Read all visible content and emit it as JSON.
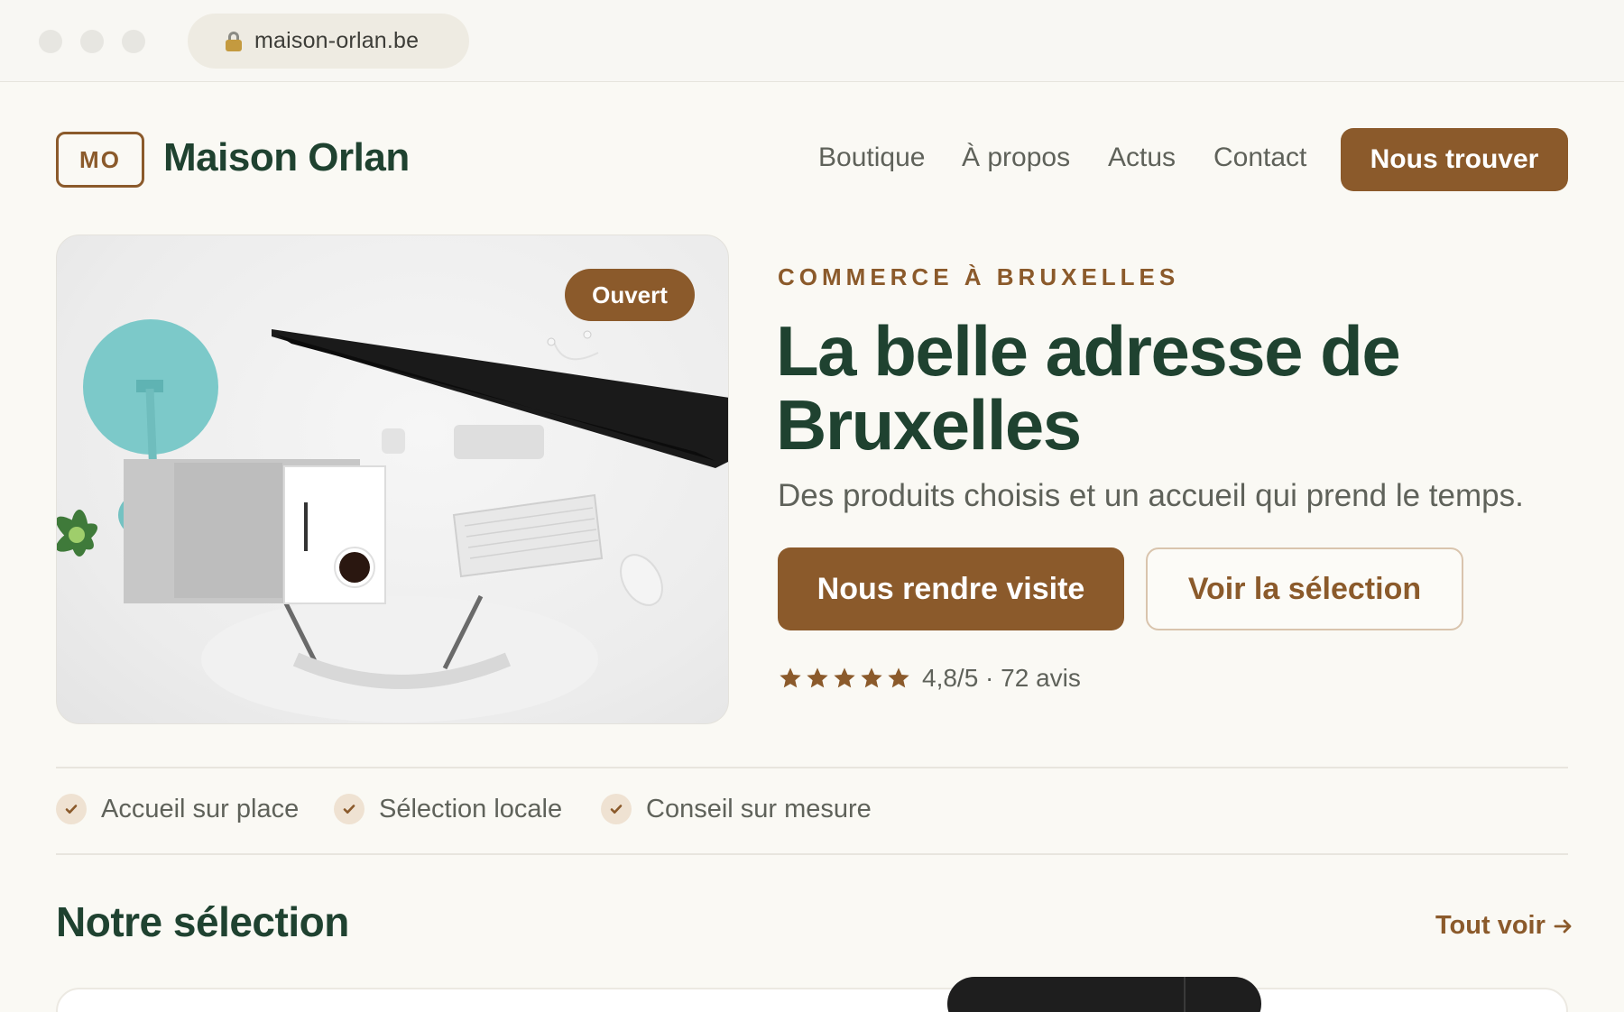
{
  "browser": {
    "url": "maison-orlan.be"
  },
  "header": {
    "logo_mark": "MO",
    "brand_name": "Maison Orlan",
    "nav": [
      "Boutique",
      "À propos",
      "Actus",
      "Contact"
    ],
    "cta_label": "Nous trouver"
  },
  "hero": {
    "badge": "Ouvert",
    "eyebrow": "COMMERCE À BRUXELLES",
    "title": "La belle adresse de Bruxelles",
    "subtitle": "Des produits choisis et un accueil qui prend le temps.",
    "primary_button": "Nous rendre visite",
    "secondary_button": "Voir la sélection",
    "rating": {
      "stars": 5,
      "text": "4,8/5 · 72 avis"
    }
  },
  "features": [
    "Accueil sur place",
    "Sélection locale",
    "Conseil sur mesure"
  ],
  "selection": {
    "title": "Notre sélection",
    "see_all": "Tout voir"
  },
  "colors": {
    "brand_brown": "#8b5a2b",
    "brand_green": "#1f4230",
    "background": "#faf9f4"
  }
}
